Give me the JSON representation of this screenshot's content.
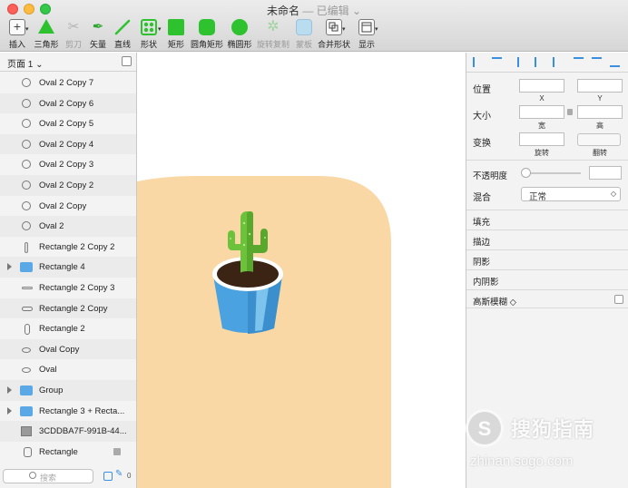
{
  "window": {
    "title": "未命名",
    "subtitle": "— 已编辑 ⌄"
  },
  "toolbar": {
    "tools": [
      {
        "label": "插入",
        "icon": "plus-icon",
        "dim": false
      },
      {
        "label": "三角形",
        "icon": "triangle-icon",
        "dim": false
      },
      {
        "label": "剪刀",
        "icon": "scissors-icon",
        "dim": true
      },
      {
        "label": "矢量",
        "icon": "pen-icon",
        "dim": false
      },
      {
        "label": "直线",
        "icon": "line-icon",
        "dim": false
      },
      {
        "label": "形状",
        "icon": "shapes-icon",
        "dim": false
      },
      {
        "label": "矩形",
        "icon": "rectangle-icon",
        "dim": false
      },
      {
        "label": "圆角矩形",
        "icon": "rounded-rectangle-icon",
        "dim": false
      },
      {
        "label": "椭圆形",
        "icon": "oval-icon",
        "dim": false
      },
      {
        "label": "旋转复制",
        "icon": "rotate-copy-icon",
        "dim": true
      },
      {
        "label": "蒙板",
        "icon": "mask-icon",
        "dim": true
      },
      {
        "label": "合并形状",
        "icon": "combine-shapes-icon",
        "dim": false
      },
      {
        "label": "显示",
        "icon": "display-icon",
        "dim": false
      }
    ]
  },
  "layers_panel": {
    "page": "页面 1 ⌄",
    "layers": [
      {
        "name": "Oval 2 Copy 7",
        "icon": "oval-icon"
      },
      {
        "name": "Oval 2 Copy 6",
        "icon": "oval-icon"
      },
      {
        "name": "Oval 2 Copy 5",
        "icon": "oval-icon"
      },
      {
        "name": "Oval 2 Copy 4",
        "icon": "oval-icon"
      },
      {
        "name": "Oval 2 Copy 3",
        "icon": "oval-icon"
      },
      {
        "name": "Oval 2 Copy 2",
        "icon": "oval-icon"
      },
      {
        "name": "Oval 2 Copy",
        "icon": "oval-icon"
      },
      {
        "name": "Oval 2",
        "icon": "oval-icon"
      },
      {
        "name": "Rectangle 2 Copy 2",
        "icon": "vertical-rectangle-icon"
      },
      {
        "name": "Rectangle 4",
        "icon": "folder-icon",
        "group": true
      },
      {
        "name": "Rectangle 2 Copy 3",
        "icon": "horizontal-rectangle-icon"
      },
      {
        "name": "Rectangle 2 Copy",
        "icon": "pill-icon"
      },
      {
        "name": "Rectangle 2",
        "icon": "vertical-pill-icon"
      },
      {
        "name": "Oval Copy",
        "icon": "flat-oval-icon"
      },
      {
        "name": "Oval",
        "icon": "flat-oval-icon"
      },
      {
        "name": "Group",
        "icon": "folder-icon",
        "group": true
      },
      {
        "name": "Rectangle 3 + Recta...",
        "icon": "folder-icon",
        "group": true
      },
      {
        "name": "3CDDBA7F-991B-44...",
        "icon": "image-icon"
      },
      {
        "name": "Rectangle",
        "icon": "rounded-rectangle-icon",
        "locked": true
      }
    ],
    "search_placeholder": "搜索",
    "count": "0"
  },
  "inspector": {
    "position_label": "位置",
    "x_label": "X",
    "y_label": "Y",
    "size_label": "大小",
    "width_label": "宽",
    "height_label": "高",
    "transform_label": "变换",
    "rotate_label": "旋转",
    "flip_label": "翻转",
    "opacity_label": "不透明度",
    "blend_label": "混合",
    "blend_value": "正常",
    "sections": [
      "填充",
      "描边",
      "阴影",
      "内阴影"
    ],
    "blur_label": "高斯模糊 ◇"
  },
  "canvas": {
    "artboard_color": "#fad8a5",
    "pot_color": "#4aa3e0",
    "soil_color": "#3b2414",
    "cactus_color": "#6cc23a"
  },
  "watermark": {
    "logo": "S",
    "text": "搜狗指南",
    "url": "zhinan.sogo.com"
  }
}
